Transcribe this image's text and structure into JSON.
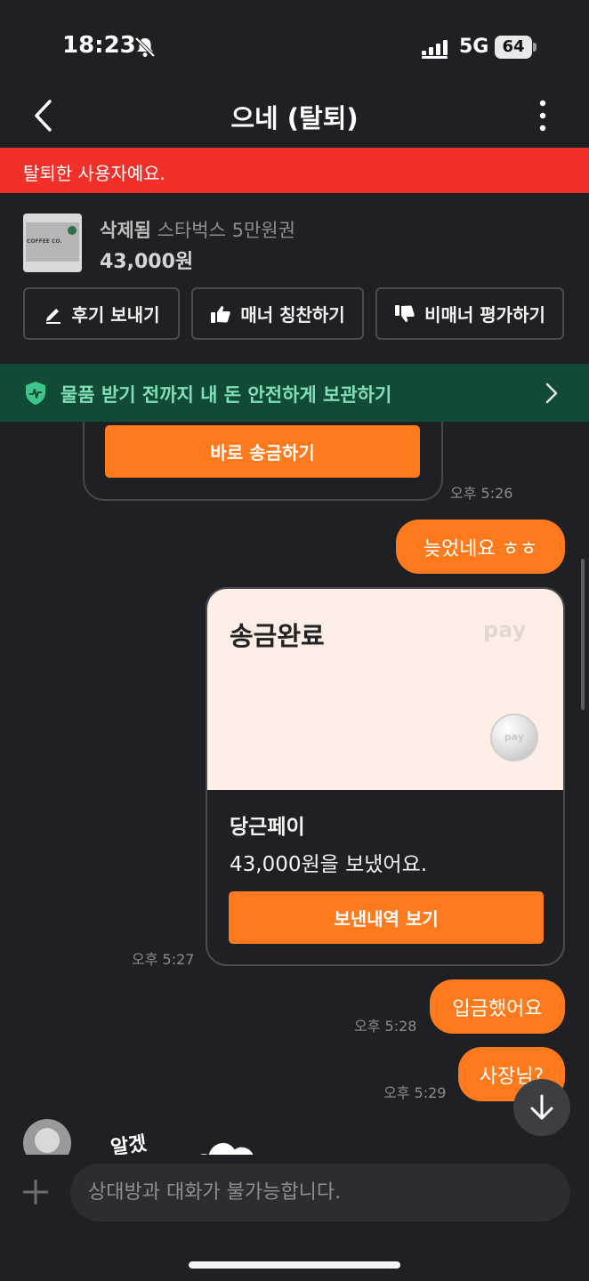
{
  "status_bar": {
    "time": "18:23",
    "network": "5G",
    "battery": "64"
  },
  "header": {
    "title": "으네 (탈퇴)"
  },
  "banner": {
    "text": "탈퇴한 사용자예요.",
    "color": "#f2302a"
  },
  "product": {
    "thumbnail_text": "COFFEE CO.",
    "status": "삭제됨",
    "name": "스타벅스 5만원권",
    "price": "43,000원"
  },
  "actions": [
    {
      "label": "후기 보내기",
      "icon": "pencil-icon"
    },
    {
      "label": "매너 칭찬하기",
      "icon": "thumbs-up-icon"
    },
    {
      "label": "비매너 평가하기",
      "icon": "thumbs-down-icon"
    }
  ],
  "safety": {
    "text": "물품 받기 전까지 내 돈 안전하게 보관하기",
    "icon": "shield-icon"
  },
  "messages": {
    "old_card_button": "바로 송금하기",
    "old_card_time": "오후 5:26",
    "m1": "늦었네요 ㅎㅎ",
    "pay_card": {
      "title": "송금완료",
      "logo": "pay",
      "coin_text": "pay",
      "subtitle": "당근페이",
      "message": "43,000원을 보냈어요.",
      "button": "보낸내역 보기",
      "time": "오후 5:27"
    },
    "m2": "입금했어요",
    "m2_time": "오후 5:28",
    "m3": "사장님?",
    "m3_time": "오후 5:29",
    "sticker_text": "알겠"
  },
  "input": {
    "placeholder": "상대방과 대화가 불가능합니다."
  },
  "colors": {
    "background": "#1f2023",
    "accent": "#ff7a1c",
    "safety_bg": "#124a38",
    "safety_text": "#7fe0b6"
  }
}
